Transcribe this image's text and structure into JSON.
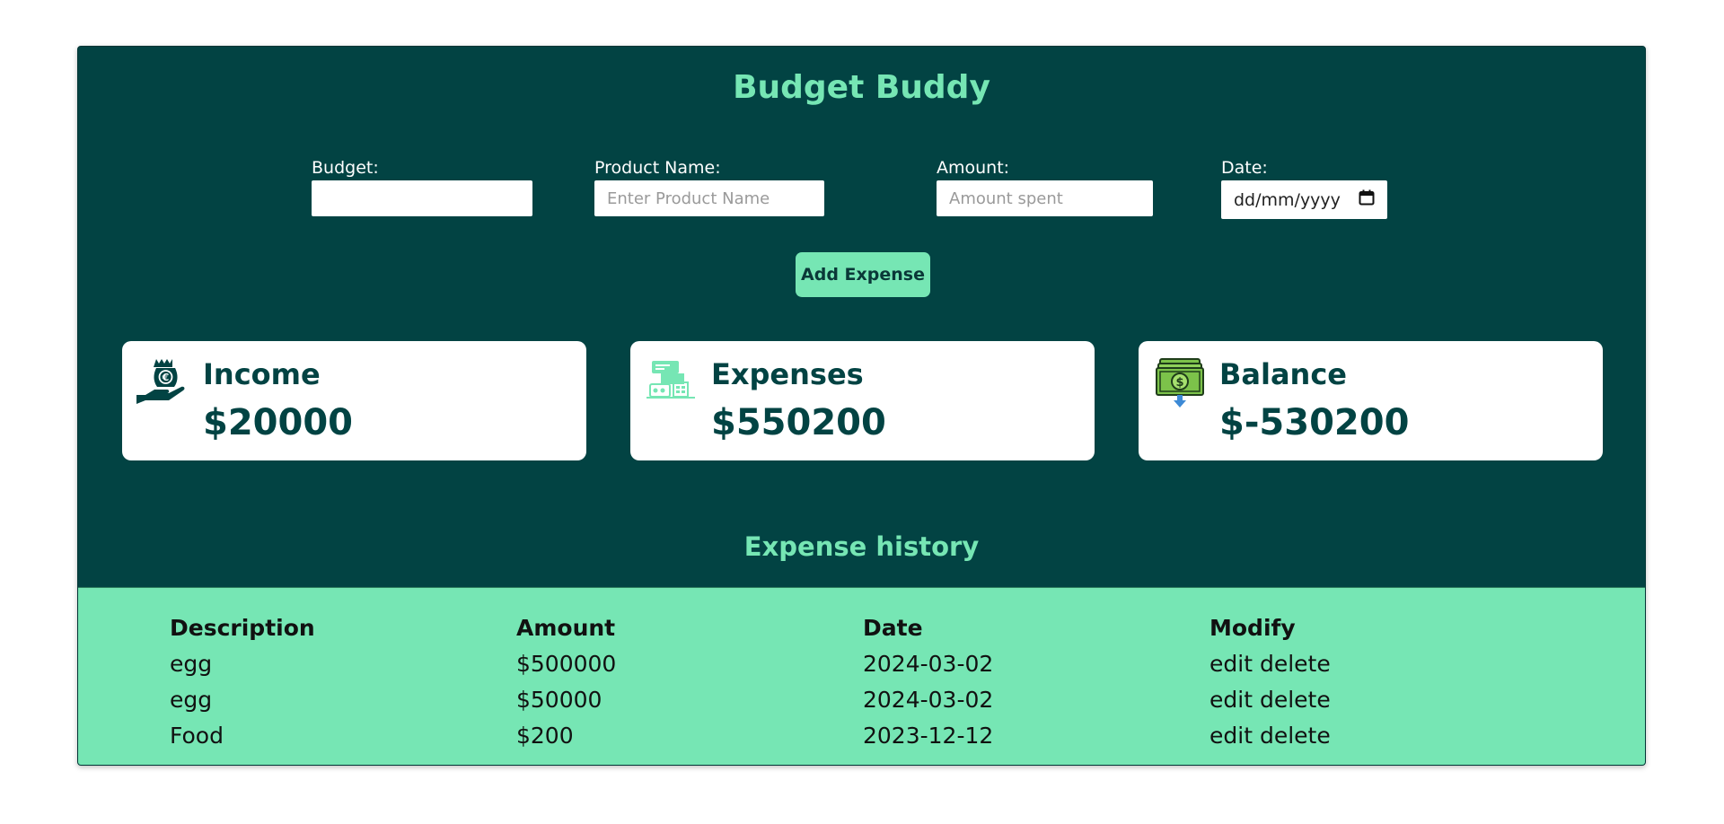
{
  "app": {
    "title": "Budget Buddy"
  },
  "form": {
    "budget": {
      "label": "Budget:",
      "value": "",
      "placeholder": ""
    },
    "product": {
      "label": "Product Name:",
      "value": "",
      "placeholder": "Enter Product Name"
    },
    "amount": {
      "label": "Amount:",
      "value": "",
      "placeholder": "Amount spent"
    },
    "date": {
      "label": "Date:",
      "placeholder": "dd/mm/yyyy",
      "icon": "calendar-icon"
    },
    "add_button": "Add Expense"
  },
  "summary": {
    "income": {
      "label": "Income",
      "value": "$20000",
      "icon": "income-hand-icon"
    },
    "expenses": {
      "label": "Expenses",
      "value": "$550200",
      "icon": "expenses-icon"
    },
    "balance": {
      "label": "Balance",
      "value": "$-530200",
      "icon": "money-stack-icon"
    }
  },
  "history": {
    "title": "Expense history",
    "columns": [
      "Description",
      "Amount",
      "Date",
      "Modify"
    ],
    "rows": [
      {
        "description": "egg",
        "amount": "$500000",
        "date": "2024-03-02",
        "edit": "edit",
        "delete": "delete"
      },
      {
        "description": "egg",
        "amount": "$50000",
        "date": "2024-03-02",
        "edit": "edit",
        "delete": "delete"
      },
      {
        "description": "Food",
        "amount": "$200",
        "date": "2023-12-12",
        "edit": "edit",
        "delete": "delete"
      }
    ]
  },
  "colors": {
    "panel": "#024343",
    "accent": "#76e6b4",
    "card": "#ffffff",
    "text_dark": "#024343"
  }
}
